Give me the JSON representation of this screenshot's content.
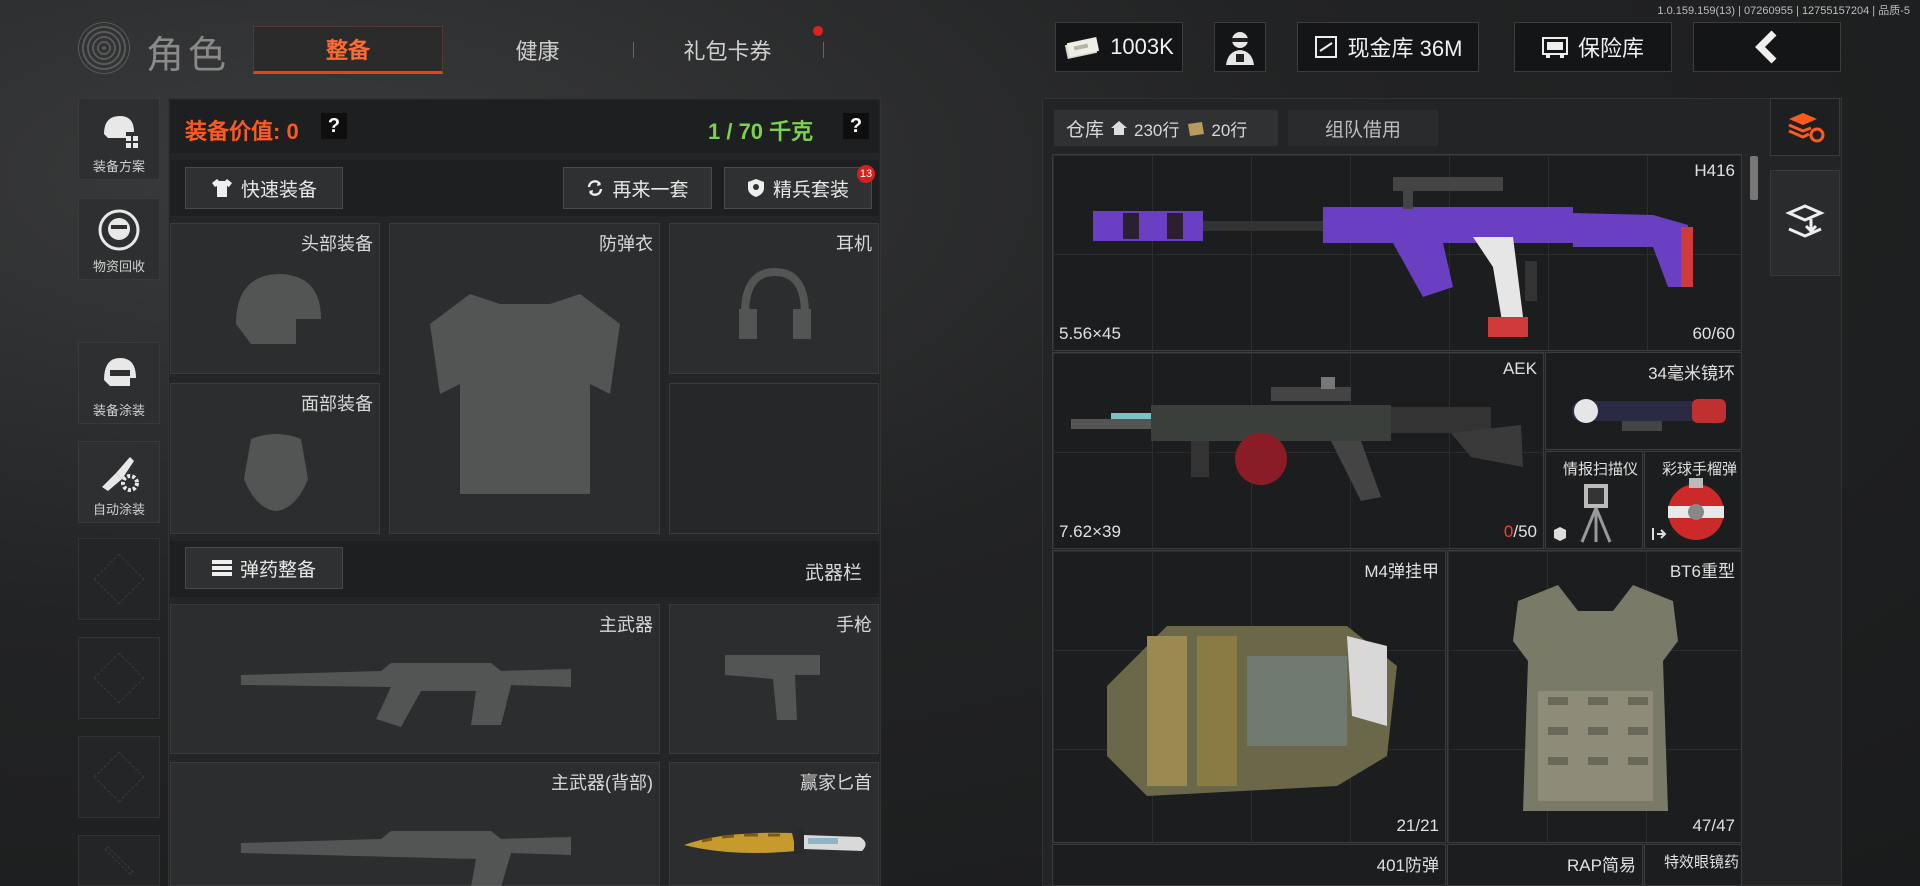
{
  "version": "1.0.159.159(13) | 07260955 | 12755157204 | 品质-5",
  "header": {
    "title": "角色",
    "tabs": [
      {
        "label": "整备",
        "active": true
      },
      {
        "label": "健康",
        "active": false
      },
      {
        "label": "礼包卡券",
        "active": false,
        "dot": true
      }
    ],
    "currency": "1003K",
    "cash_vault": "现金库 36M",
    "safe_box": "保险库"
  },
  "sidebar": [
    {
      "label": "装备方案",
      "icon": "helmet-grid-icon"
    },
    {
      "label": "物资回收",
      "icon": "recycle-face-icon"
    },
    {
      "label": "装备涂装",
      "icon": "helmet-paint-icon"
    },
    {
      "label": "自动涂装",
      "icon": "brush-gear-icon"
    }
  ],
  "loadout": {
    "value_label": "装备价值: 0",
    "help": "?",
    "weight": "1 / 70 千克",
    "quick_equip": "快速装备",
    "again": "再来一套",
    "elite": "精兵套装",
    "elite_badge": "13",
    "slots": {
      "head": "头部装备",
      "armor": "防弹衣",
      "headset": "耳机",
      "face": "面部装备",
      "primary": "主武器",
      "pistol": "手枪",
      "primary_back": "主武器(背部)",
      "knife": "赢家匕首"
    },
    "ammo_sort": "弹药整备",
    "weapon_bar": "武器栏"
  },
  "vault": {
    "tab_label": "仓库",
    "rows_home": "230行",
    "rows_bag": "20行",
    "team_borrow": "组队借用",
    "items": [
      {
        "name": "H416",
        "caliber": "5.56×45",
        "count": "60/60"
      },
      {
        "name": "AEK",
        "caliber": "7.62×39",
        "count_current": "0",
        "count_total": "/50"
      },
      {
        "name": "34毫米镜环"
      },
      {
        "name": "情报扫描仪"
      },
      {
        "name": "彩球手榴弹"
      },
      {
        "name": "M4弹挂甲",
        "count": "21/21"
      },
      {
        "name": "BT6重型",
        "count": "47/47"
      },
      {
        "name": "401防弹"
      },
      {
        "name": "RAP简易"
      },
      {
        "name": "特效眼镜药"
      }
    ]
  },
  "colors": {
    "accent": "#ff5a1e",
    "weight": "#7cd34a",
    "badge": "#d62020"
  }
}
